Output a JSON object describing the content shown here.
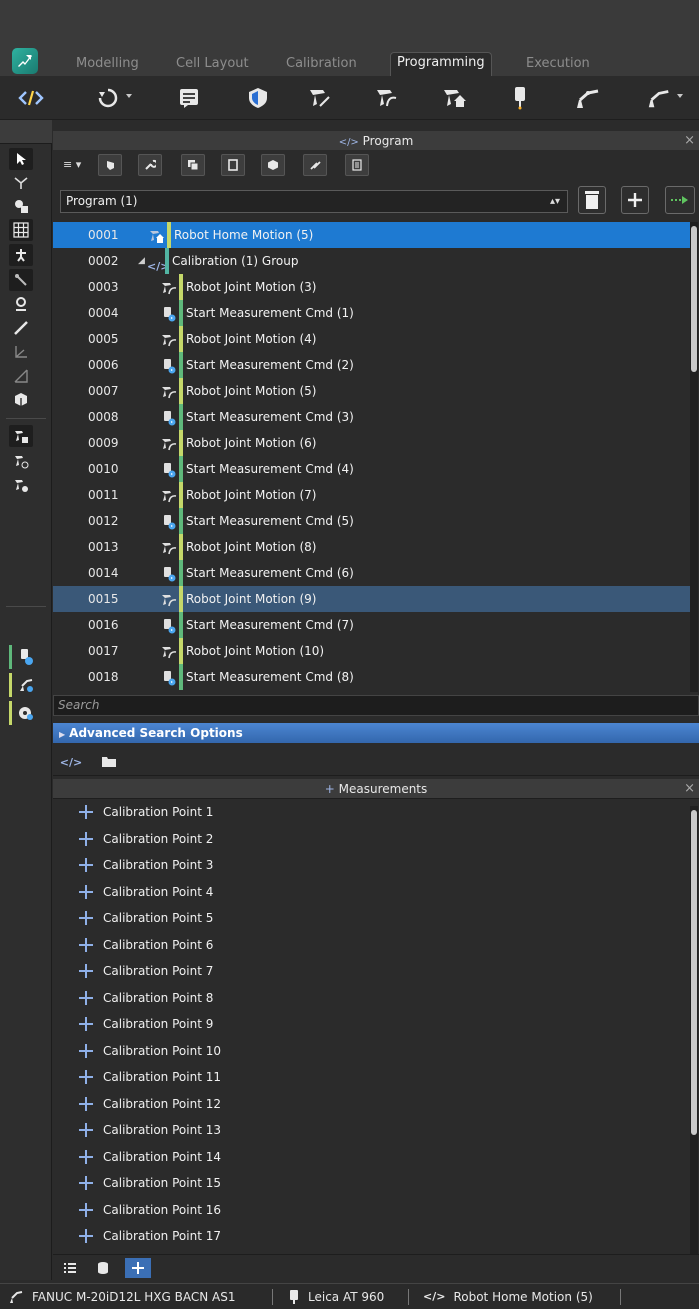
{
  "colors": {
    "accent_blue": "#1e7ad2",
    "selected_row": "#3a5878",
    "stripe_yellow": "#c5d86a",
    "stripe_green": "#5fb87b",
    "stripe_teal": "#52b5a3",
    "adv_bar": "#3f77c0"
  },
  "tabs": [
    {
      "label": "Modelling"
    },
    {
      "label": "Cell Layout"
    },
    {
      "label": "Calibration"
    },
    {
      "label": "Programming"
    },
    {
      "label": "Execution"
    }
  ],
  "toolbar": {
    "icons": [
      "code-icon",
      "refresh-dropdown-icon",
      "notes-icon",
      "shield-icon",
      "robot-linear-motion-icon",
      "robot-joint-motion-icon",
      "robot-home-motion-icon",
      "probe-icon",
      "robot-arm-icon",
      "robot-arm-dropdown-icon"
    ]
  },
  "program_panel": {
    "title": "Program",
    "selected_program": "Program (1)",
    "rows": [
      {
        "num": "0001",
        "label": "Robot Home Motion (5)",
        "kind": "home",
        "state": "selected-primary"
      },
      {
        "num": "0002",
        "label": "Calibration (1) Group",
        "kind": "group",
        "state": ""
      },
      {
        "num": "0003",
        "label": "Robot Joint Motion (3)",
        "kind": "joint",
        "state": ""
      },
      {
        "num": "0004",
        "label": "Start Measurement Cmd (1)",
        "kind": "measure",
        "state": ""
      },
      {
        "num": "0005",
        "label": "Robot Joint Motion (4)",
        "kind": "joint",
        "state": ""
      },
      {
        "num": "0006",
        "label": "Start Measurement Cmd (2)",
        "kind": "measure",
        "state": ""
      },
      {
        "num": "0007",
        "label": "Robot Joint Motion (5)",
        "kind": "joint",
        "state": ""
      },
      {
        "num": "0008",
        "label": "Start Measurement Cmd (3)",
        "kind": "measure",
        "state": ""
      },
      {
        "num": "0009",
        "label": "Robot Joint Motion (6)",
        "kind": "joint",
        "state": ""
      },
      {
        "num": "0010",
        "label": "Start Measurement Cmd (4)",
        "kind": "measure",
        "state": ""
      },
      {
        "num": "0011",
        "label": "Robot Joint Motion (7)",
        "kind": "joint",
        "state": ""
      },
      {
        "num": "0012",
        "label": "Start Measurement Cmd (5)",
        "kind": "measure",
        "state": ""
      },
      {
        "num": "0013",
        "label": "Robot Joint Motion (8)",
        "kind": "joint",
        "state": ""
      },
      {
        "num": "0014",
        "label": "Start Measurement Cmd (6)",
        "kind": "measure",
        "state": ""
      },
      {
        "num": "0015",
        "label": "Robot Joint Motion (9)",
        "kind": "joint",
        "state": "selected-secondary"
      },
      {
        "num": "0016",
        "label": "Start Measurement Cmd (7)",
        "kind": "measure",
        "state": ""
      },
      {
        "num": "0017",
        "label": "Robot Joint Motion (10)",
        "kind": "joint",
        "state": ""
      },
      {
        "num": "0018",
        "label": "Start Measurement Cmd (8)",
        "kind": "measure",
        "state": ""
      }
    ]
  },
  "search": {
    "placeholder": "Search"
  },
  "advanced_search": {
    "label": "Advanced Search Options"
  },
  "measurements_panel": {
    "title": "Measurements",
    "items": [
      "Calibration Point 1",
      "Calibration Point 2",
      "Calibration Point 3",
      "Calibration Point 4",
      "Calibration Point 5",
      "Calibration Point 6",
      "Calibration Point 7",
      "Calibration Point 8",
      "Calibration Point 9",
      "Calibration Point 10",
      "Calibration Point 11",
      "Calibration Point 12",
      "Calibration Point 13",
      "Calibration Point 14",
      "Calibration Point 15",
      "Calibration Point 16",
      "Calibration Point 17"
    ]
  },
  "status_bar": {
    "robot": "FANUC M-20iD12L HXG BACN AS1",
    "tracker": "Leica AT 960",
    "current_step": "Robot Home Motion (5)"
  }
}
